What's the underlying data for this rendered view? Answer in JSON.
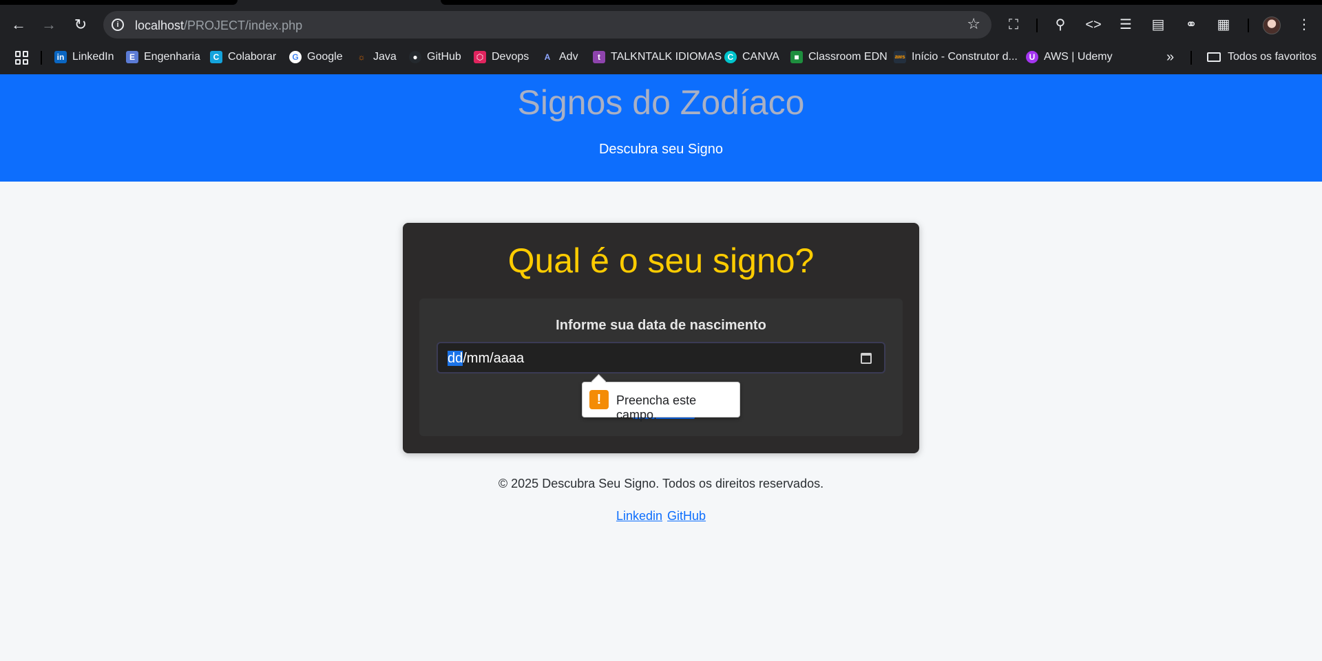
{
  "browser": {
    "url_host": "localhost",
    "url_path": "/PROJECT/index.php",
    "bookmarks": [
      {
        "label": "LinkedIn",
        "icon": "linkedin-icon",
        "color": "#0a66c2"
      },
      {
        "label": "Engenharia",
        "icon": "engenharia-icon",
        "color": "#5b7bd5"
      },
      {
        "label": "Colaborar",
        "icon": "colaborar-icon",
        "color": "#14a3dc"
      },
      {
        "label": "Google",
        "icon": "google-icon",
        "color": "#ffffff"
      },
      {
        "label": "Java",
        "icon": "java-icon",
        "color": "#e76f00"
      },
      {
        "label": "GitHub",
        "icon": "github-icon",
        "color": "#24292e"
      },
      {
        "label": "Devops",
        "icon": "devops-icon",
        "color": "#e0245e"
      },
      {
        "label": "Adv",
        "icon": "adv-icon",
        "color": "#3b5bdb"
      },
      {
        "label": "TALKNTALK IDIOMAS",
        "icon": "talkntalk-icon",
        "color": "#8e44ad"
      },
      {
        "label": "CANVA",
        "icon": "canva-icon",
        "color": "#00c4cc"
      },
      {
        "label": "Classroom EDN",
        "icon": "classroom-icon",
        "color": "#1e8e3e"
      },
      {
        "label": "Início - Construtor d...",
        "icon": "aws-icon",
        "color": "#232f3e"
      },
      {
        "label": "AWS | Udemy",
        "icon": "udemy-icon",
        "color": "#a435f0"
      }
    ],
    "all_bookmarks": "Todos os favoritos"
  },
  "header": {
    "title": "Signos do Zodíaco",
    "subtitle": "Descubra seu Signo"
  },
  "card": {
    "heading": "Qual é o seu signo?",
    "label": "Informe sua data de nascimento",
    "date_value_selected": "dd",
    "date_value_rest": "/mm/aaaa"
  },
  "validation": {
    "message": "Preencha este campo."
  },
  "footer": {
    "copyright": "© 2025 Descubra Seu Signo. Todos os direitos reservados.",
    "links": [
      "Linkedin",
      "GitHub"
    ]
  },
  "colors": {
    "header_bg": "#0d6efd",
    "card_bg": "#2c2a2a",
    "heading": "#ffcc00",
    "link": "#0d6efd"
  }
}
